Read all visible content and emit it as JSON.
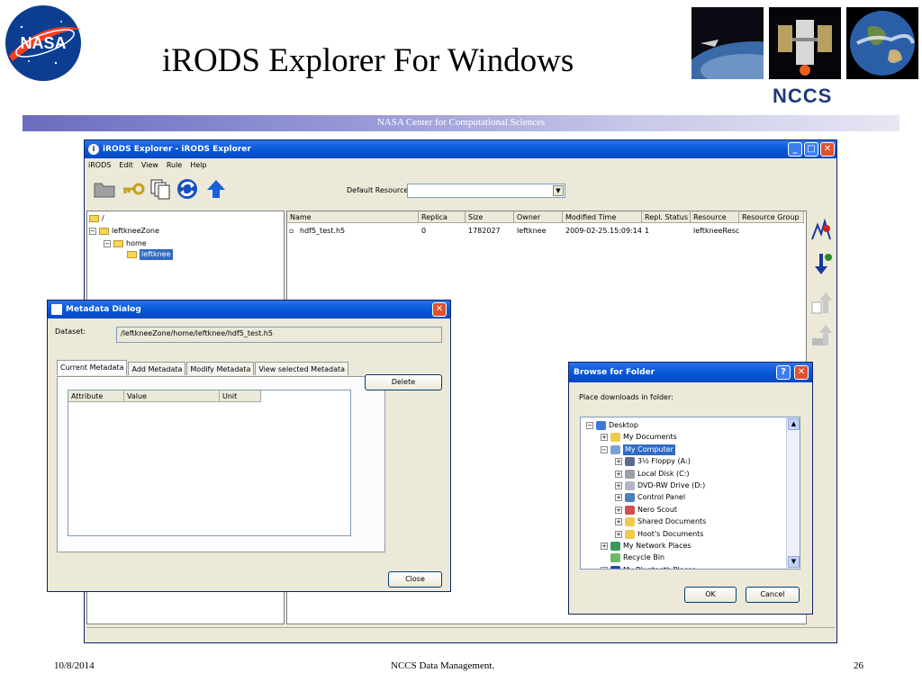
{
  "slide": {
    "title": "iRODS Explorer For Windows",
    "org_label": "NCCS",
    "banner": "NASA Center for Computational Sciences",
    "logo_text": "NASA",
    "footer": {
      "date": "10/8/2014",
      "center": "NCCS Data Management.",
      "page": "26"
    }
  },
  "explorer": {
    "title": "iRODS Explorer - iRODS Explorer",
    "menu": [
      "iRODS",
      "Edit",
      "View",
      "Rule",
      "Help"
    ],
    "default_resource_label": "Default Resource",
    "default_resource_value": "",
    "tree": {
      "root": "/",
      "zone": "leftkneeZone",
      "home": "home",
      "user": "leftknee"
    },
    "columns": [
      "Name",
      "Replica",
      "Size",
      "Owner",
      "Modified Time",
      "Repl. Status",
      "Resource",
      "Resource Group"
    ],
    "rows": [
      [
        "hdf5_test.h5",
        "0",
        "1782027",
        "leftknee",
        "2009-02-25.15:09:14",
        "1",
        "leftkneeResc",
        ""
      ]
    ]
  },
  "metadata": {
    "title": "Metadata Dialog",
    "dataset_label": "Dataset:",
    "dataset_value": "/leftkneeZone/home/leftknee/hdf5_test.h5",
    "tabs": [
      "Current Metadata",
      "Add Metadata",
      "Modify Metadata",
      "View selected Metadata"
    ],
    "columns": [
      "Attribute",
      "Value",
      "Unit"
    ],
    "delete_button": "Delete",
    "close_button": "Close"
  },
  "browse": {
    "title": "Browse for Folder",
    "prompt": "Place downloads in folder:",
    "items": [
      {
        "label": "Desktop",
        "level": 0,
        "expander": "-",
        "icon": "desktop-icon"
      },
      {
        "label": "My Documents",
        "level": 1,
        "expander": "+",
        "icon": "folder-icon"
      },
      {
        "label": "My Computer",
        "level": 1,
        "expander": "-",
        "icon": "computer-icon",
        "selected": true
      },
      {
        "label": "3½ Floppy (A:)",
        "level": 2,
        "expander": "+",
        "icon": "floppy-icon"
      },
      {
        "label": "Local Disk (C:)",
        "level": 2,
        "expander": "+",
        "icon": "disk-icon"
      },
      {
        "label": "DVD-RW Drive (D:)",
        "level": 2,
        "expander": "+",
        "icon": "dvd-icon"
      },
      {
        "label": "Control Panel",
        "level": 2,
        "expander": "+",
        "icon": "control-panel-icon"
      },
      {
        "label": "Nero Scout",
        "level": 2,
        "expander": "+",
        "icon": "nero-icon"
      },
      {
        "label": "Shared Documents",
        "level": 2,
        "expander": "+",
        "icon": "folder-icon"
      },
      {
        "label": "Hoot's Documents",
        "level": 2,
        "expander": "+",
        "icon": "folder-icon"
      },
      {
        "label": "My Network Places",
        "level": 1,
        "expander": "+",
        "icon": "network-icon"
      },
      {
        "label": "Recycle Bin",
        "level": 1,
        "expander": "",
        "icon": "recycle-bin-icon"
      },
      {
        "label": "My Bluetooth Places",
        "level": 1,
        "expander": "+",
        "icon": "bluetooth-icon"
      }
    ],
    "ok_button": "OK",
    "cancel_button": "Cancel"
  },
  "colors": {
    "xp_title": "#0a5ad8",
    "selection": "#316ac5",
    "banner": "#8080c8",
    "nccs": "#1f3a7a"
  }
}
